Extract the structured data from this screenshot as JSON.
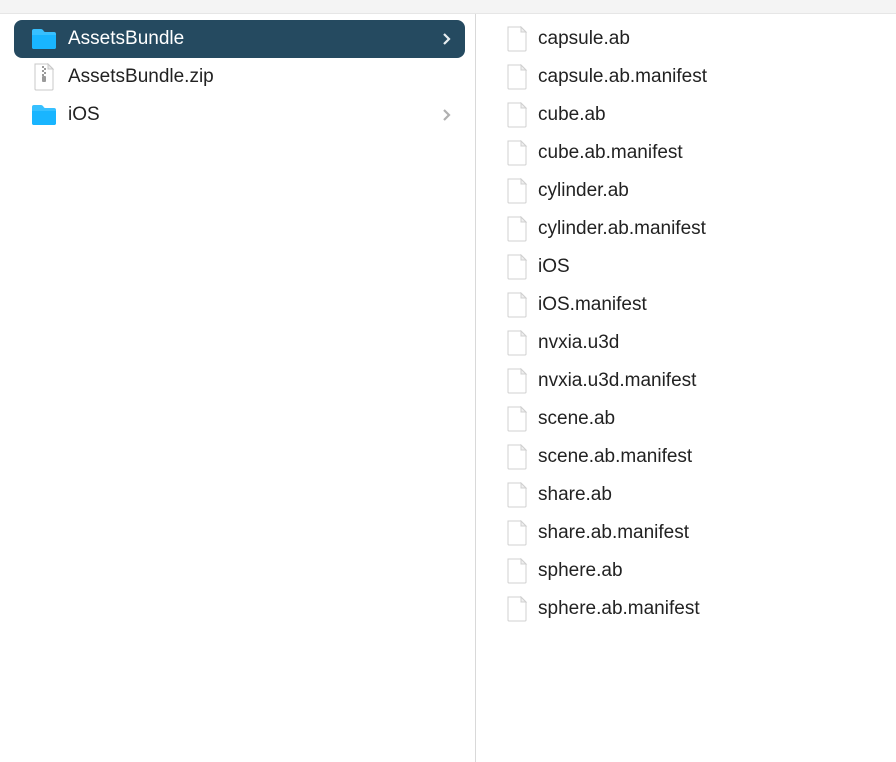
{
  "left_column": {
    "items": [
      {
        "label": "AssetsBundle",
        "type": "folder",
        "selected": true,
        "expandable": true
      },
      {
        "label": "AssetsBundle.zip",
        "type": "zip",
        "selected": false,
        "expandable": false
      },
      {
        "label": "iOS",
        "type": "folder",
        "selected": false,
        "expandable": true
      }
    ]
  },
  "right_column": {
    "items": [
      {
        "label": "capsule.ab",
        "type": "file"
      },
      {
        "label": "capsule.ab.manifest",
        "type": "file"
      },
      {
        "label": "cube.ab",
        "type": "file"
      },
      {
        "label": "cube.ab.manifest",
        "type": "file"
      },
      {
        "label": "cylinder.ab",
        "type": "file"
      },
      {
        "label": "cylinder.ab.manifest",
        "type": "file"
      },
      {
        "label": "iOS",
        "type": "file"
      },
      {
        "label": "iOS.manifest",
        "type": "file"
      },
      {
        "label": "nvxia.u3d",
        "type": "file"
      },
      {
        "label": "nvxia.u3d.manifest",
        "type": "file"
      },
      {
        "label": "scene.ab",
        "type": "file"
      },
      {
        "label": "scene.ab.manifest",
        "type": "file"
      },
      {
        "label": "share.ab",
        "type": "file"
      },
      {
        "label": "share.ab.manifest",
        "type": "file"
      },
      {
        "label": "sphere.ab",
        "type": "file"
      },
      {
        "label": "sphere.ab.manifest",
        "type": "file"
      }
    ]
  }
}
